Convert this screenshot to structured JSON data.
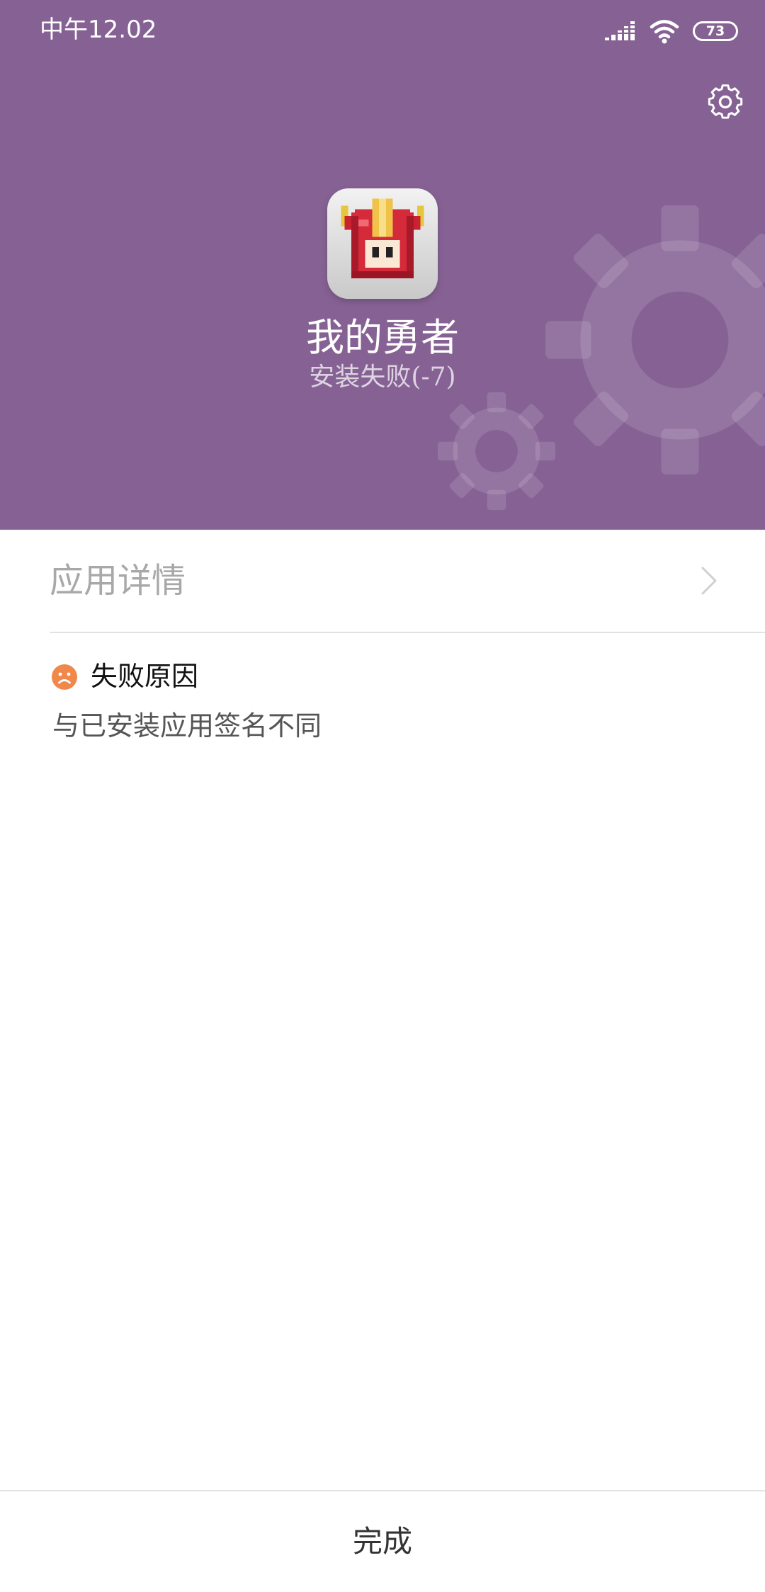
{
  "status_bar": {
    "time": "中午12.02",
    "battery": "73",
    "signal_icon": "signal-bars-icon",
    "wifi_icon": "wifi-icon"
  },
  "header": {
    "background_color": "#866294",
    "settings_icon": "gear-icon",
    "app_icon": "pixel-hero-helmet-icon",
    "app_name": "我的勇者",
    "install_status": "安装失败(-7)"
  },
  "details": {
    "label": "应用详情",
    "chevron_icon": "chevron-right-icon"
  },
  "failure": {
    "icon": "sad-face-icon",
    "icon_color": "#f0884a",
    "title": "失败原因",
    "reason": "与已安装应用签名不同"
  },
  "footer": {
    "done_label": "完成"
  }
}
